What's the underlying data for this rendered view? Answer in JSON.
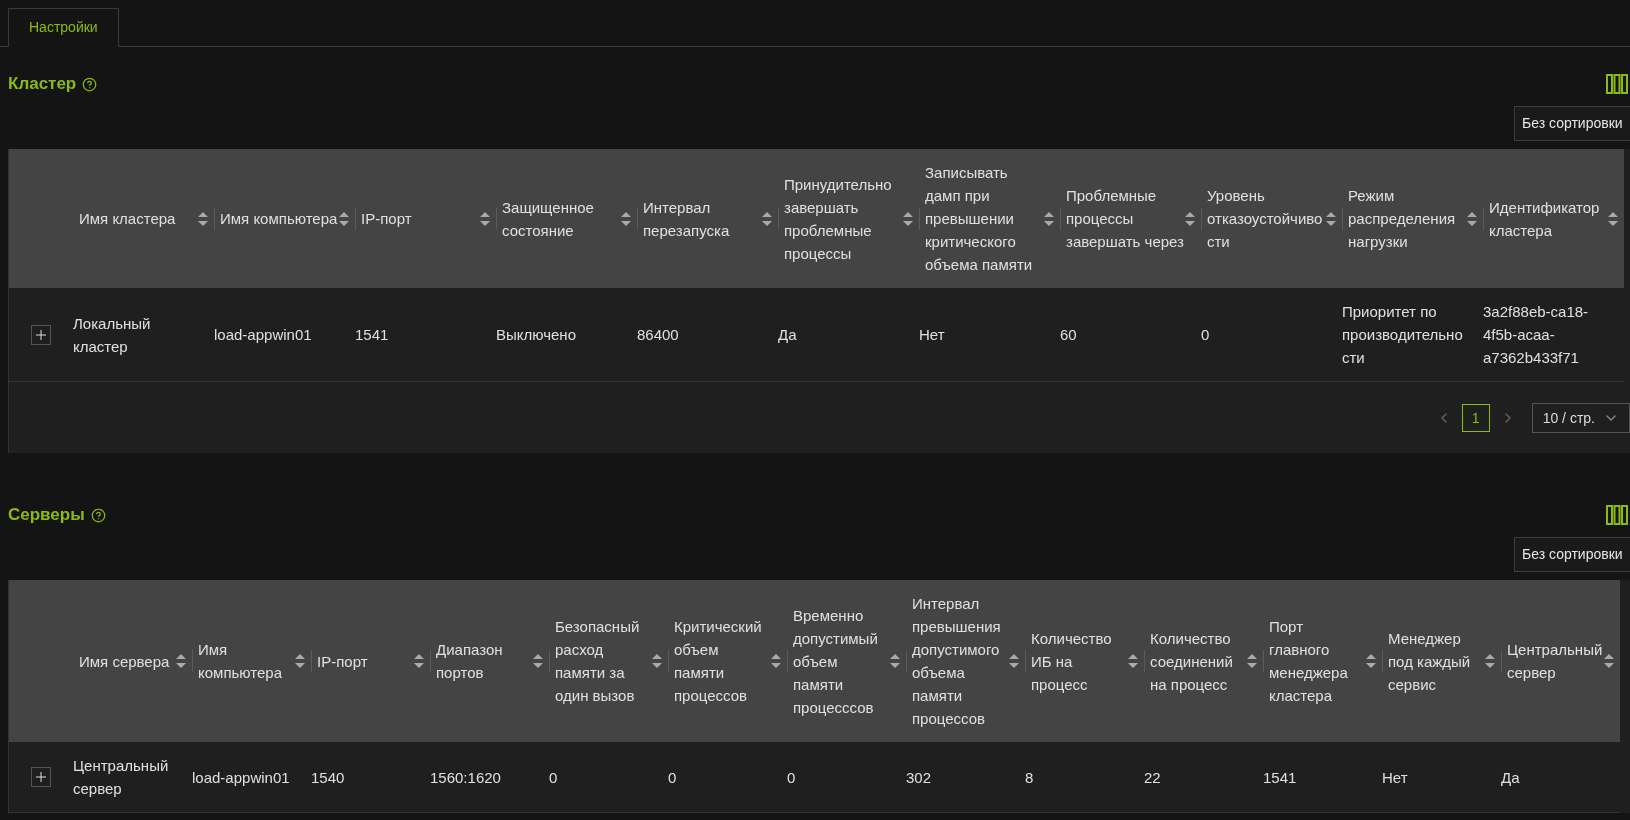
{
  "tabs": [
    {
      "label": "Настройки",
      "selected": true
    }
  ],
  "sections": [
    {
      "title": "Кластер",
      "sort_button": "Без сортировки",
      "columns": [
        "Имя кластера",
        "Имя компьютера",
        "IP-порт",
        "Защищенное состояние",
        "Интервал перезапуска",
        "Принудительно завершать проблемные процессы",
        "Записывать дамп при превышении критического объема памяти",
        "Проблемные процессы завершать через",
        "Уровень отказоустойчивости",
        "Режим распределения нагрузки",
        "Идентификатор кластера"
      ],
      "rows": [
        {
          "expanded": false,
          "cells": [
            "Локальный кластер",
            "load-appwin01",
            "1541",
            "Выключено",
            "86400",
            "Да",
            "Нет",
            "60",
            "0",
            "Приоритет по производительности",
            "3a2f88eb-ca18-4f5b-acaa-a7362b433f71"
          ]
        }
      ],
      "pagination": {
        "pages": [
          {
            "label": "1",
            "selected": true
          }
        ],
        "page_size": "10 / стр."
      }
    },
    {
      "title": "Серверы",
      "sort_button": "Без сортировки",
      "columns": [
        "Имя сервера",
        "Имя компьютера",
        "IP-порт",
        "Диапазон портов",
        "Безопасный расход памяти за один вызов",
        "Критический объем памяти процессов",
        "Временно допустимый объем памяти процесссов",
        "Интервал превышения допустимого объема памяти процессов",
        "Количество ИБ на процесс",
        "Количество соединений на процесс",
        "Порт главного менеджера кластера",
        "Менеджер под каждый сервис",
        "Центральный сервер"
      ],
      "rows": [
        {
          "expanded": false,
          "cells": [
            "Центральный сервер",
            "load-appwin01",
            "1540",
            "1560:1620",
            "0",
            "0",
            "0",
            "302",
            "8",
            "22",
            "1541",
            "Нет",
            "Да"
          ]
        }
      ]
    }
  ]
}
